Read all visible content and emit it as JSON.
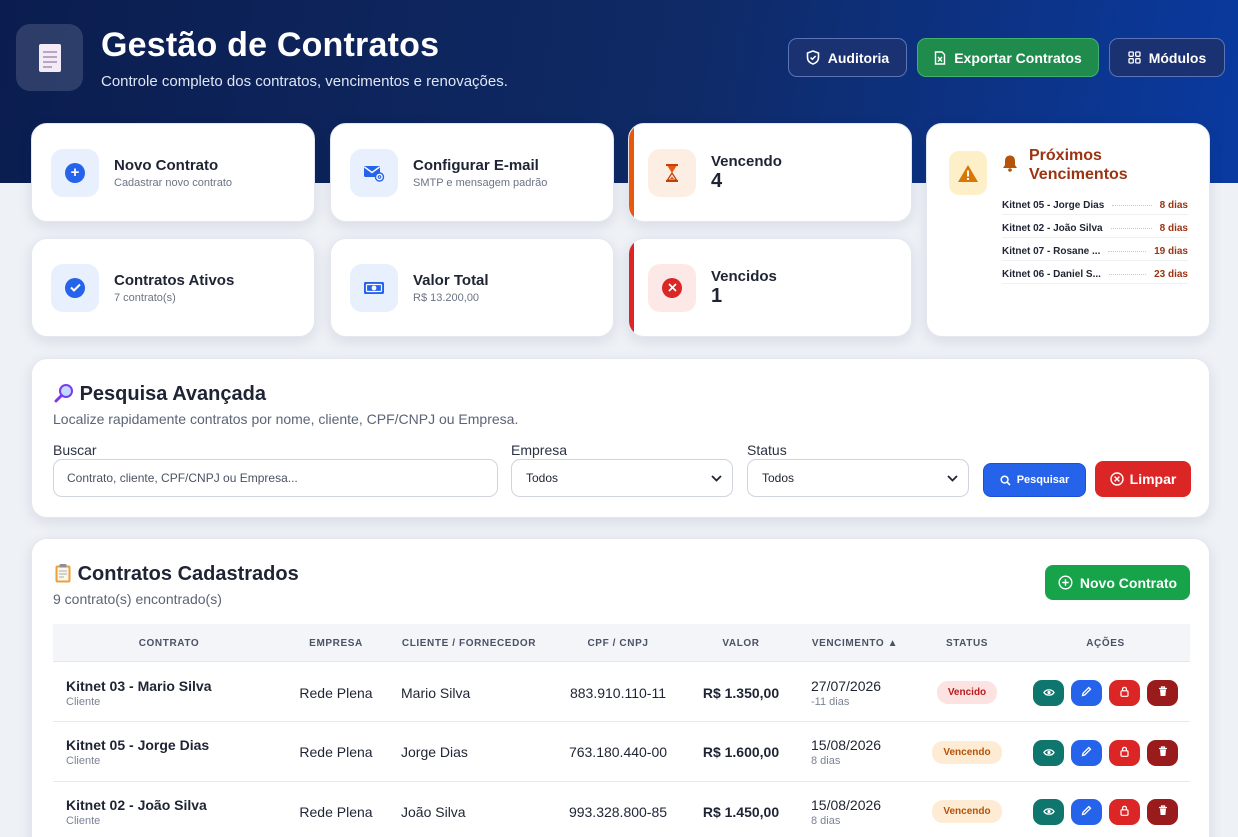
{
  "header": {
    "title": "Gestão de Contratos",
    "subtitle": "Controle completo dos contratos, vencimentos e renovações.",
    "buttons": {
      "audit": "Auditoria",
      "export": "Exportar Contratos",
      "modules": "Módulos"
    }
  },
  "cards": {
    "novo": {
      "title": "Novo Contrato",
      "sub": "Cadastrar novo contrato"
    },
    "email": {
      "title": "Configurar E-mail",
      "sub": "SMTP e mensagem padrão"
    },
    "vencendo": {
      "title": "Vencendo",
      "count": "4"
    },
    "ativos": {
      "title": "Contratos Ativos",
      "sub": "7 contrato(s)"
    },
    "valor": {
      "title": "Valor Total",
      "sub": "R$ 13.200,00"
    },
    "vencidos": {
      "title": "Vencidos",
      "count": "1"
    }
  },
  "proximos": {
    "title": "Próximos Vencimentos",
    "items": [
      {
        "name": "Kitnet 05 - Jorge Dias",
        "days": "8 dias"
      },
      {
        "name": "Kitnet 02 - João Silva",
        "days": "8 dias"
      },
      {
        "name": "Kitnet 07 - Rosane ...",
        "days": "19 dias"
      },
      {
        "name": "Kitnet 06 - Daniel S...",
        "days": "23 dias"
      }
    ]
  },
  "search": {
    "title": "Pesquisa Avançada",
    "desc": "Localize rapidamente contratos por nome, cliente, CPF/CNPJ ou Empresa.",
    "buscar_label": "Buscar",
    "buscar_placeholder": "Contrato, cliente, CPF/CNPJ ou Empresa...",
    "empresa_label": "Empresa",
    "empresa_value": "Todos",
    "status_label": "Status",
    "status_value": "Todos",
    "pesquisar": "Pesquisar",
    "limpar": "Limpar"
  },
  "list": {
    "title": "Contratos Cadastrados",
    "count": "9 contrato(s) encontrado(s)",
    "novo": "Novo Contrato",
    "columns": {
      "contrato": "CONTRATO",
      "empresa": "EMPRESA",
      "cliente": "CLIENTE / FORNECEDOR",
      "cpf": "CPF / CNPJ",
      "valor": "VALOR",
      "venc": "VENCIMENTO ▲",
      "status": "STATUS",
      "acoes": "AÇÕES"
    },
    "rows": [
      {
        "contrato": "Kitnet 03 - Mario Silva",
        "tipo": "Cliente",
        "empresa": "Rede Plena",
        "cliente": "Mario Silva",
        "cpf": "883.910.110-11",
        "valor": "R$ 1.350,00",
        "data": "27/07/2026",
        "dias": "-11 dias",
        "status": "Vencido"
      },
      {
        "contrato": "Kitnet 05 - Jorge Dias",
        "tipo": "Cliente",
        "empresa": "Rede Plena",
        "cliente": "Jorge Dias",
        "cpf": "763.180.440-00",
        "valor": "R$ 1.600,00",
        "data": "15/08/2026",
        "dias": "8 dias",
        "status": "Vencendo"
      },
      {
        "contrato": "Kitnet 02 - João Silva",
        "tipo": "Cliente",
        "empresa": "Rede Plena",
        "cliente": "João Silva",
        "cpf": "993.328.800-85",
        "valor": "R$ 1.450,00",
        "data": "15/08/2026",
        "dias": "8 dias",
        "status": "Vencendo"
      }
    ]
  },
  "icons": {
    "logo": "document-icon",
    "audit": "shield-icon",
    "export": "excel-icon",
    "modules": "grid-icon",
    "plus": "plus-circle-icon",
    "email": "mail-at-icon",
    "hourglass": "hourglass-icon",
    "check": "check-circle-icon",
    "money": "money-icon",
    "x": "x-circle-icon",
    "warning": "warning-icon",
    "bell": "bell-icon",
    "magnifier": "magnifier-icon",
    "clipboard": "clipboard-icon",
    "view": "eye-icon",
    "edit": "pencil-icon",
    "lock": "lock-icon",
    "delete": "trash-icon"
  },
  "colors": {
    "hero_dark": "#0b1d4f",
    "hero_light": "#0a3aa0",
    "primary": "#2563eb",
    "success": "#16a34a",
    "danger": "#dc2626",
    "warning_text": "#9a3412"
  }
}
